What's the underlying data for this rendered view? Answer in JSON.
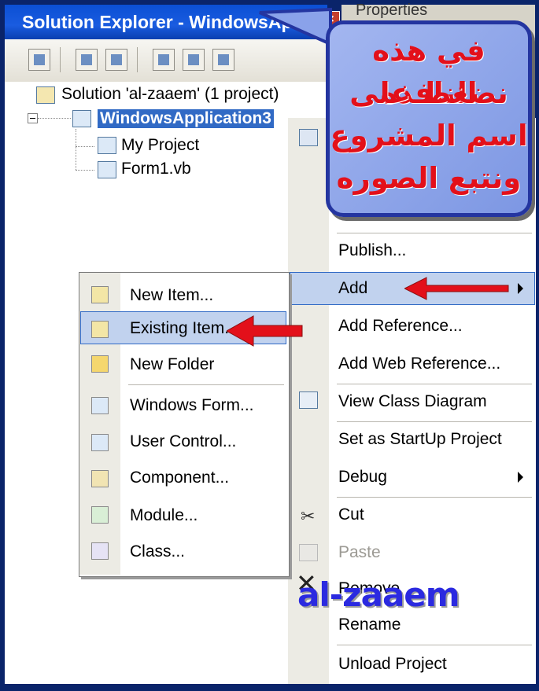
{
  "window": {
    "title": "Solution Explorer - WindowsAp...",
    "close_glyph": "×",
    "right_strip_text": "Properties"
  },
  "toolbar": {
    "icons": [
      "properties-icon",
      "show-all-files-icon",
      "refresh-icon",
      "view-code-icon",
      "view-designer-icon",
      "class-diagram-icon"
    ]
  },
  "tree": {
    "solution_label": "Solution 'al-zaaem' (1 project)",
    "project_label": "WindowsApplication3",
    "items": [
      {
        "label": "My Project",
        "icon": "my-project-icon"
      },
      {
        "label": "Form1.vb",
        "icon": "form-file-icon"
      }
    ]
  },
  "context_menu": {
    "items": [
      {
        "label": "Publish..."
      },
      {
        "label": "Add",
        "has_submenu": true
      },
      {
        "label": "Add Reference..."
      },
      {
        "label": "Add Web Reference..."
      },
      {
        "label": "View Class Diagram"
      },
      {
        "label": "Set as StartUp Project"
      },
      {
        "label": "Debug",
        "has_submenu": true
      },
      {
        "label": "Cut"
      },
      {
        "label": "Paste",
        "disabled": true
      },
      {
        "label": "Remove"
      },
      {
        "label": "Rename"
      },
      {
        "label": "Unload Project"
      }
    ]
  },
  "add_submenu": {
    "items": [
      {
        "label": "New Item...",
        "icon": "new-item-icon"
      },
      {
        "label": "Existing Item...",
        "icon": "existing-item-icon",
        "highlighted": true
      },
      {
        "label": "New Folder",
        "icon": "new-folder-icon"
      },
      {
        "label": "Windows Form...",
        "icon": "windows-form-icon"
      },
      {
        "label": "User Control...",
        "icon": "user-control-icon"
      },
      {
        "label": "Component...",
        "icon": "component-icon"
      },
      {
        "label": "Module...",
        "icon": "module-icon"
      },
      {
        "label": "Class...",
        "icon": "class-icon"
      }
    ]
  },
  "callout": {
    "lines": [
      "في هذه النافذه",
      "نضغط على",
      "اسم المشروع",
      "ونتبع الصوره"
    ]
  },
  "watermark": "al-zaaem",
  "colors": {
    "highlight": "#c1d2ee",
    "highlight_border": "#316ac5",
    "arrow_red": "#e3101a",
    "callout_fill": "#8aa2ea",
    "watermark": "#2b2ae0"
  }
}
